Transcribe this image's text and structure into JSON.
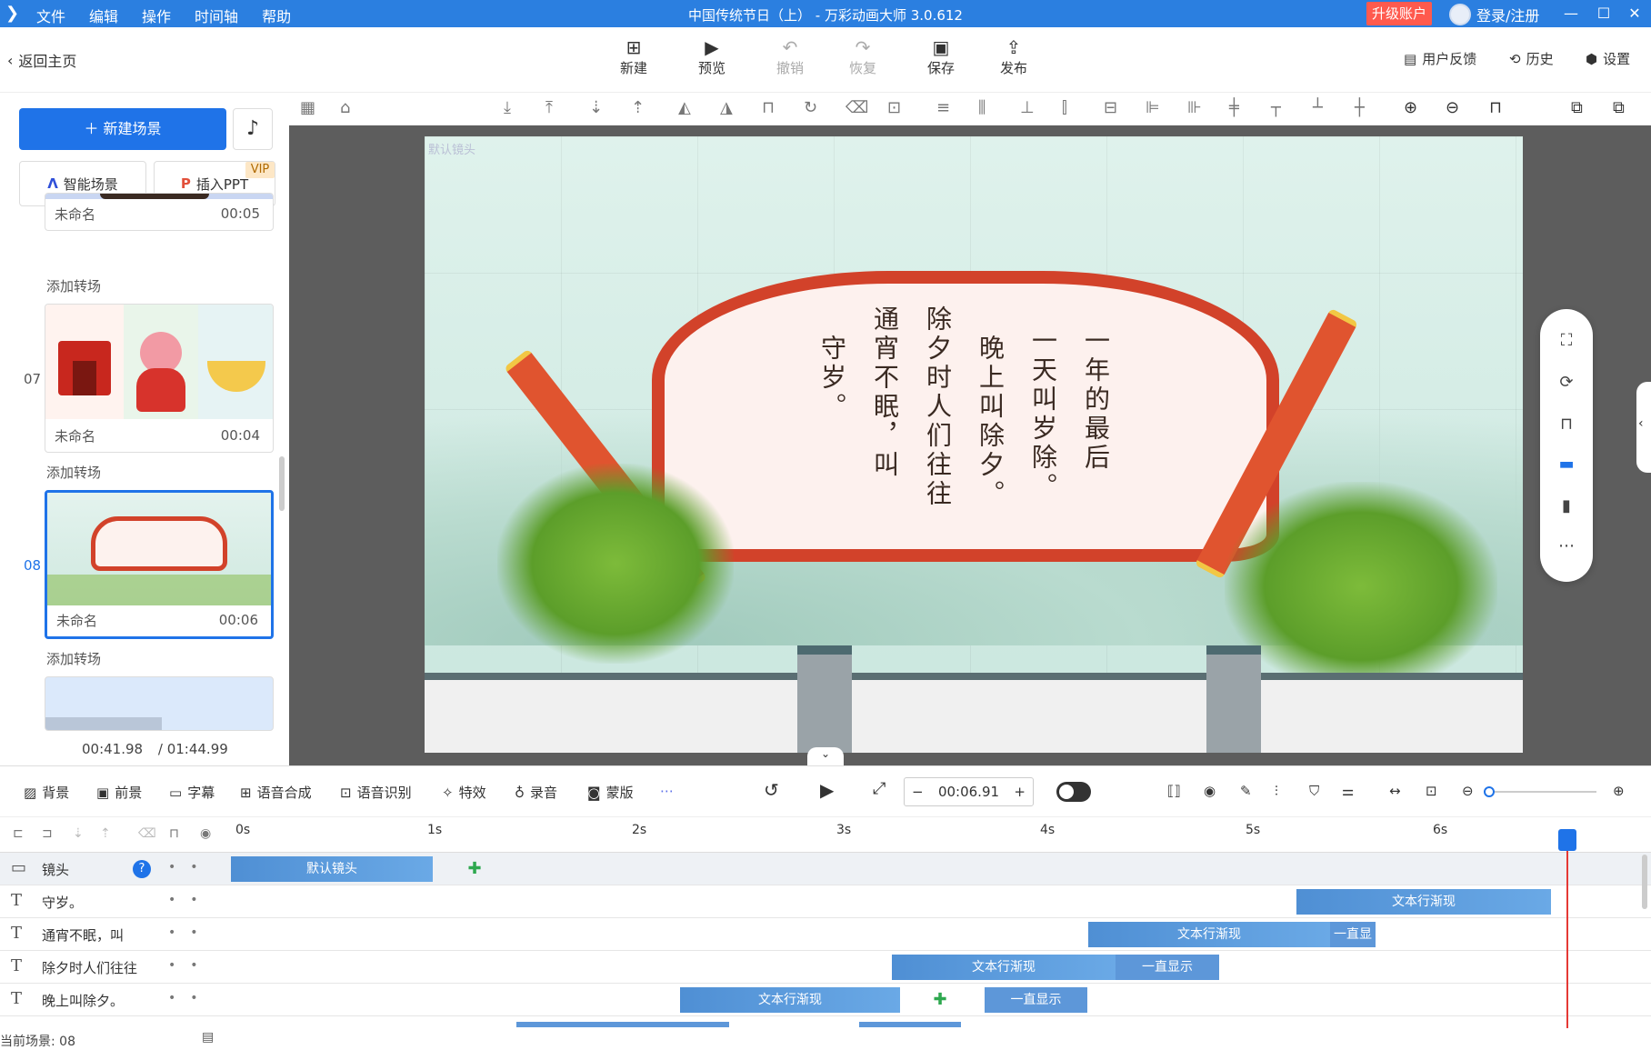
{
  "titlebar": {
    "menu": [
      "文件",
      "编辑",
      "操作",
      "时间轴",
      "帮助"
    ],
    "title": "中国传统节日（上） - 万彩动画大师 3.0.612",
    "upgrade": "升级账户",
    "login": "登录/注册",
    "colors": {
      "bar": "#2b7fe0",
      "upgrade": "#ff5a4e"
    }
  },
  "toolbar": {
    "back": "返回主页",
    "buttons": [
      {
        "label": "新建",
        "icon": "plus-square-icon"
      },
      {
        "label": "预览",
        "icon": "play-icon"
      },
      {
        "label": "撤销",
        "icon": "undo-icon"
      },
      {
        "label": "恢复",
        "icon": "redo-icon"
      },
      {
        "label": "保存",
        "icon": "save-icon"
      },
      {
        "label": "发布",
        "icon": "publish-icon"
      }
    ],
    "right": {
      "feedback": "用户反馈",
      "history": "历史",
      "settings": "设置"
    }
  },
  "left": {
    "new_scene": "新建场景",
    "smart_scene": "智能场景",
    "insert_ppt": "插入PPT",
    "vip": "VIP",
    "scenes": [
      {
        "num": "",
        "name": "未命名",
        "time": "00:05"
      },
      {
        "num": "07",
        "name": "未命名",
        "time": "00:04"
      },
      {
        "num": "08",
        "name": "未命名",
        "time": "00:06"
      }
    ],
    "add_transition": "添加转场",
    "current_time": "00:41.98",
    "total_time": "/ 01:44.99"
  },
  "stage": {
    "camera_label": "默认镜头",
    "lines": [
      "一年的最后",
      "一天叫岁除。",
      "晚上叫除夕。",
      "除夕时人们往往",
      "通宵不眠，叫",
      "守岁。"
    ]
  },
  "timeline_bar": {
    "items": [
      "背景",
      "前景",
      "字幕",
      "语音合成",
      "语音识别",
      "特效",
      "录音",
      "蒙版"
    ],
    "time": "00:06.91"
  },
  "ruler": [
    "0s",
    "1s",
    "2s",
    "3s",
    "4s",
    "5s",
    "6s"
  ],
  "tracks": [
    {
      "name": "镜头",
      "clips": [
        {
          "label": "默认镜头"
        }
      ]
    },
    {
      "name": "守岁。",
      "clips": [
        {
          "label": "文本行渐现"
        }
      ]
    },
    {
      "name": "通宵不眠，叫",
      "clips": [
        {
          "label": "文本行渐现"
        },
        {
          "label": "一直显"
        }
      ]
    },
    {
      "name": "除夕时人们往往",
      "clips": [
        {
          "label": "文本行渐现"
        },
        {
          "label": "一直显示"
        }
      ]
    },
    {
      "name": "晚上叫除夕。",
      "clips": [
        {
          "label": "文本行渐现"
        },
        {
          "label": "一直显示"
        }
      ]
    }
  ],
  "current_scene": "当前场景: 08"
}
